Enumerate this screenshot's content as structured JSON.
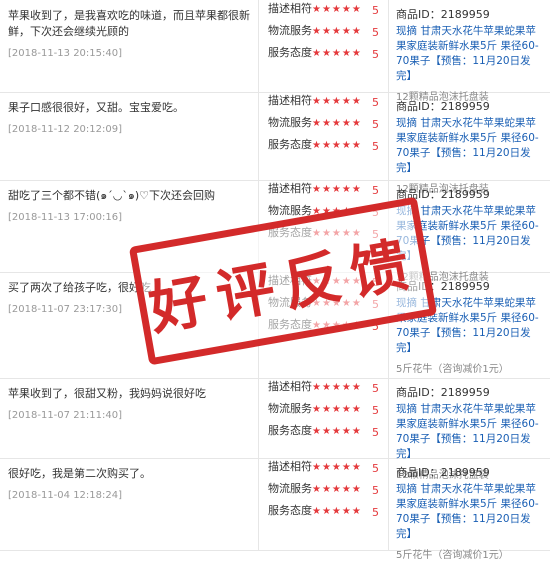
{
  "labels": {
    "desc_match": "描述相符",
    "logistics": "物流服务",
    "service": "服务态度",
    "stars": "★★★★★",
    "score": "5",
    "product_id_prefix": "商品ID：",
    "product_id": "2189959"
  },
  "reviews": [
    {
      "comment": "苹果收到了，是我喜欢吃的味道，而且苹果都很新鲜，下次还会继续光顾的",
      "date": "[2018-11-13 20:15:40]",
      "product_title": "现摘 甘肃天水花牛苹果蛇果苹果家庭装新鲜水果5斤 果径60-70果子【预售：11月20日发完】",
      "variant": "12颗精品泡沫托盘装"
    },
    {
      "comment": "果子口感很很好，又甜。宝宝爱吃。",
      "date": "[2018-11-12 20:12:09]",
      "product_title": "现摘 甘肃天水花牛苹果蛇果苹果家庭装新鲜水果5斤 果径60-70果子【预售：11月20日发完】",
      "variant": "12颗精品泡沫托盘装"
    },
    {
      "comment": "甜吃了三个都不错(๑´◡`๑)♡下次还会回购",
      "date": "[2018-11-13 17:00:16]",
      "product_title": "现摘 甘肃天水花牛苹果蛇果苹果家庭装新鲜水果5斤 果径60-70果子【预售：11月20日发完】",
      "variant": "12颗精品泡沫托盘装"
    },
    {
      "comment": "买了两次了给孩子吃，很好吃",
      "date": "[2018-11-07 23:17:30]",
      "product_title": "现摘 甘肃天水花牛苹果蛇果苹果家庭装新鲜水果5斤 果径60-70果子【预售：11月20日发完】",
      "variant": "5斤花牛（咨询减价1元）"
    },
    {
      "comment": "苹果收到了，很甜又粉，我妈妈说很好吃",
      "date": "[2018-11-07 21:11:40]",
      "product_title": "现摘 甘肃天水花牛苹果蛇果苹果家庭装新鲜水果5斤 果径60-70果子【预售：11月20日发完】",
      "variant": "12颗精品泡沫托盘装"
    },
    {
      "comment": "很好吃，我是第二次购买了。",
      "date": "[2018-11-04 12:18:24]",
      "product_title": "现摘 甘肃天水花牛苹果蛇果苹果家庭装新鲜水果5斤 果径60-70果子【预售：11月20日发完】",
      "variant": "5斤花牛（咨询减价1元）"
    }
  ],
  "stamp": {
    "text": "好评反馈",
    "color": "#d32a2a"
  }
}
